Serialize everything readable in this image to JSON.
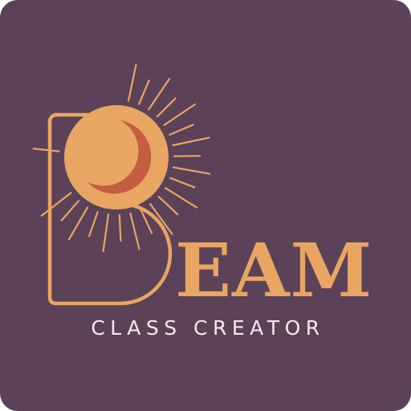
{
  "logo": {
    "wordmark": "EAM",
    "tagline": "CLASS CREATOR"
  },
  "colors": {
    "background": "#5b4258",
    "accent_orange": "#e9a562",
    "crescent_red": "#c45d42",
    "tagline_white": "#f3e9ee"
  },
  "icons": [
    "sun-icon",
    "crescent-moon-icon",
    "letter-b-outline"
  ]
}
